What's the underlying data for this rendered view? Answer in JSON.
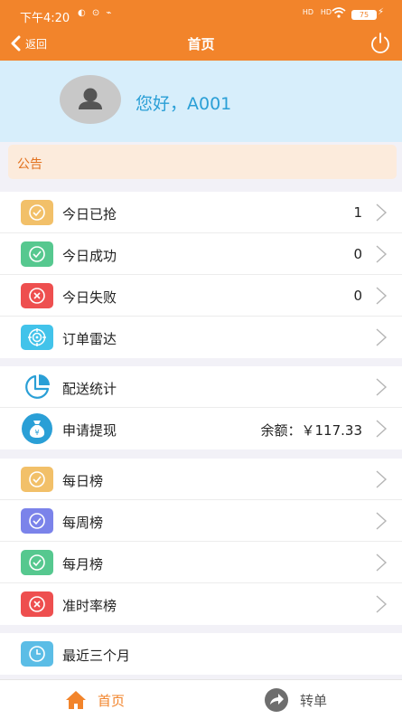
{
  "status_bar": {
    "time": "下午4:20",
    "left_icons": "◐ ⊙ ⌁",
    "network1": "HD",
    "network2": "HD",
    "battery": "75"
  },
  "nav": {
    "back_label": "返回",
    "title": "首页"
  },
  "profile": {
    "greeting": "您好，A001"
  },
  "notice": {
    "label": "公告"
  },
  "group1": [
    {
      "label": "今日已抢",
      "value": "1",
      "icon": "check-icon",
      "color": "#f2c069"
    },
    {
      "label": "今日成功",
      "value": "0",
      "icon": "check-icon",
      "color": "#56c88f"
    },
    {
      "label": "今日失败",
      "value": "0",
      "icon": "close-icon",
      "color": "#ee4f4f"
    },
    {
      "label": "订单雷达",
      "value": "",
      "icon": "radar-icon",
      "color": "#42c3ea"
    }
  ],
  "group2": [
    {
      "label": "配送统计",
      "value": "",
      "icon": "pie-chart-icon",
      "color": "#2a9fd6"
    },
    {
      "label": "申请提现",
      "value": "余额：￥117.33",
      "icon": "money-bag-icon",
      "color": "#2a9fd6"
    }
  ],
  "group3": [
    {
      "label": "每日榜",
      "value": "",
      "icon": "check-icon",
      "color": "#f2c069"
    },
    {
      "label": "每周榜",
      "value": "",
      "icon": "check-icon",
      "color": "#7b83ea"
    },
    {
      "label": "每月榜",
      "value": "",
      "icon": "check-icon",
      "color": "#56c88f"
    },
    {
      "label": "准时率榜",
      "value": "",
      "icon": "close-icon",
      "color": "#ee4f4f"
    }
  ],
  "group4": [
    {
      "label": "最近三个月",
      "value": "",
      "icon": "clock-icon",
      "color": "#5bbde6"
    }
  ],
  "tabbar": {
    "home_label": "首页",
    "transfer_label": "转单",
    "active_color": "#f2842b"
  }
}
